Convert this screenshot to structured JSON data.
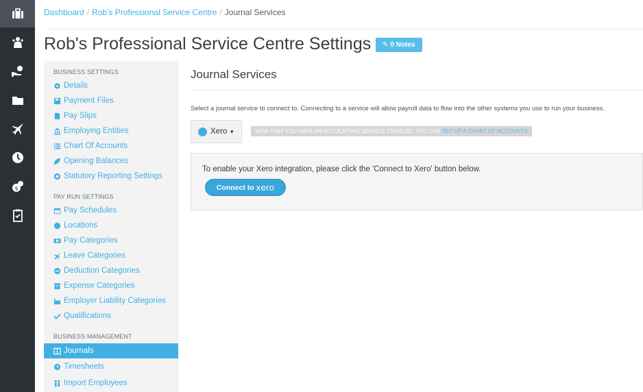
{
  "breadcrumb": {
    "items": [
      "Dashboard",
      "Rob's Professional Service Centre",
      "Journal Services"
    ],
    "separator": "/"
  },
  "page": {
    "title": "Rob's Professional Service Centre Settings",
    "notes_label": "0 Notes"
  },
  "sidebar": {
    "sections": [
      {
        "title": "BUSINESS SETTINGS",
        "items": [
          {
            "label": "Details",
            "icon": "gear-icon"
          },
          {
            "label": "Payment Files",
            "icon": "floppy-icon"
          },
          {
            "label": "Pay Slips",
            "icon": "file-icon"
          },
          {
            "label": "Employing Entities",
            "icon": "bank-icon"
          },
          {
            "label": "Chart Of Accounts",
            "icon": "list-icon"
          },
          {
            "label": "Opening Balances",
            "icon": "leaf-icon"
          },
          {
            "label": "Statutory Reporting Settings",
            "icon": "lifebuoy-icon"
          }
        ]
      },
      {
        "title": "PAY RUN SETTINGS",
        "items": [
          {
            "label": "Pay Schedules",
            "icon": "calendar-icon"
          },
          {
            "label": "Locations",
            "icon": "globe-icon"
          },
          {
            "label": "Pay Categories",
            "icon": "money-icon"
          },
          {
            "label": "Leave Categories",
            "icon": "plane-icon"
          },
          {
            "label": "Deduction Categories",
            "icon": "minus-circle-icon"
          },
          {
            "label": "Expense Categories",
            "icon": "archive-icon"
          },
          {
            "label": "Employer Liability Categories",
            "icon": "industry-icon"
          },
          {
            "label": "Qualifications",
            "icon": "check-icon"
          }
        ]
      },
      {
        "title": "BUSINESS MANAGEMENT",
        "items": [
          {
            "label": "Journals",
            "icon": "columns-icon",
            "active": true
          },
          {
            "label": "Timesheets",
            "icon": "clock-icon"
          },
          {
            "label": "Import Employees",
            "icon": "users-icon"
          }
        ]
      }
    ]
  },
  "main": {
    "title": "Journal Services",
    "description": "Select a journal service to connect to. Connecting to a service will allow payroll data to flow into the other systems you use to run your business.",
    "service_label": "Xero",
    "notice_text": "NOW THAT YOU HAVE AN ACCOUNTING SERVICE ENABLED, YOU CAN",
    "notice_link": "SET UP A CHART OF ACCOUNTS",
    "panel_text": "To enable your Xero integration, please click the 'Connect to Xero' button below.",
    "connect_label": "Connect to",
    "connect_brand": "xero"
  },
  "colors": {
    "accent": "#41afe4",
    "rail": "#2b3035",
    "notes": "#57c0ea"
  }
}
